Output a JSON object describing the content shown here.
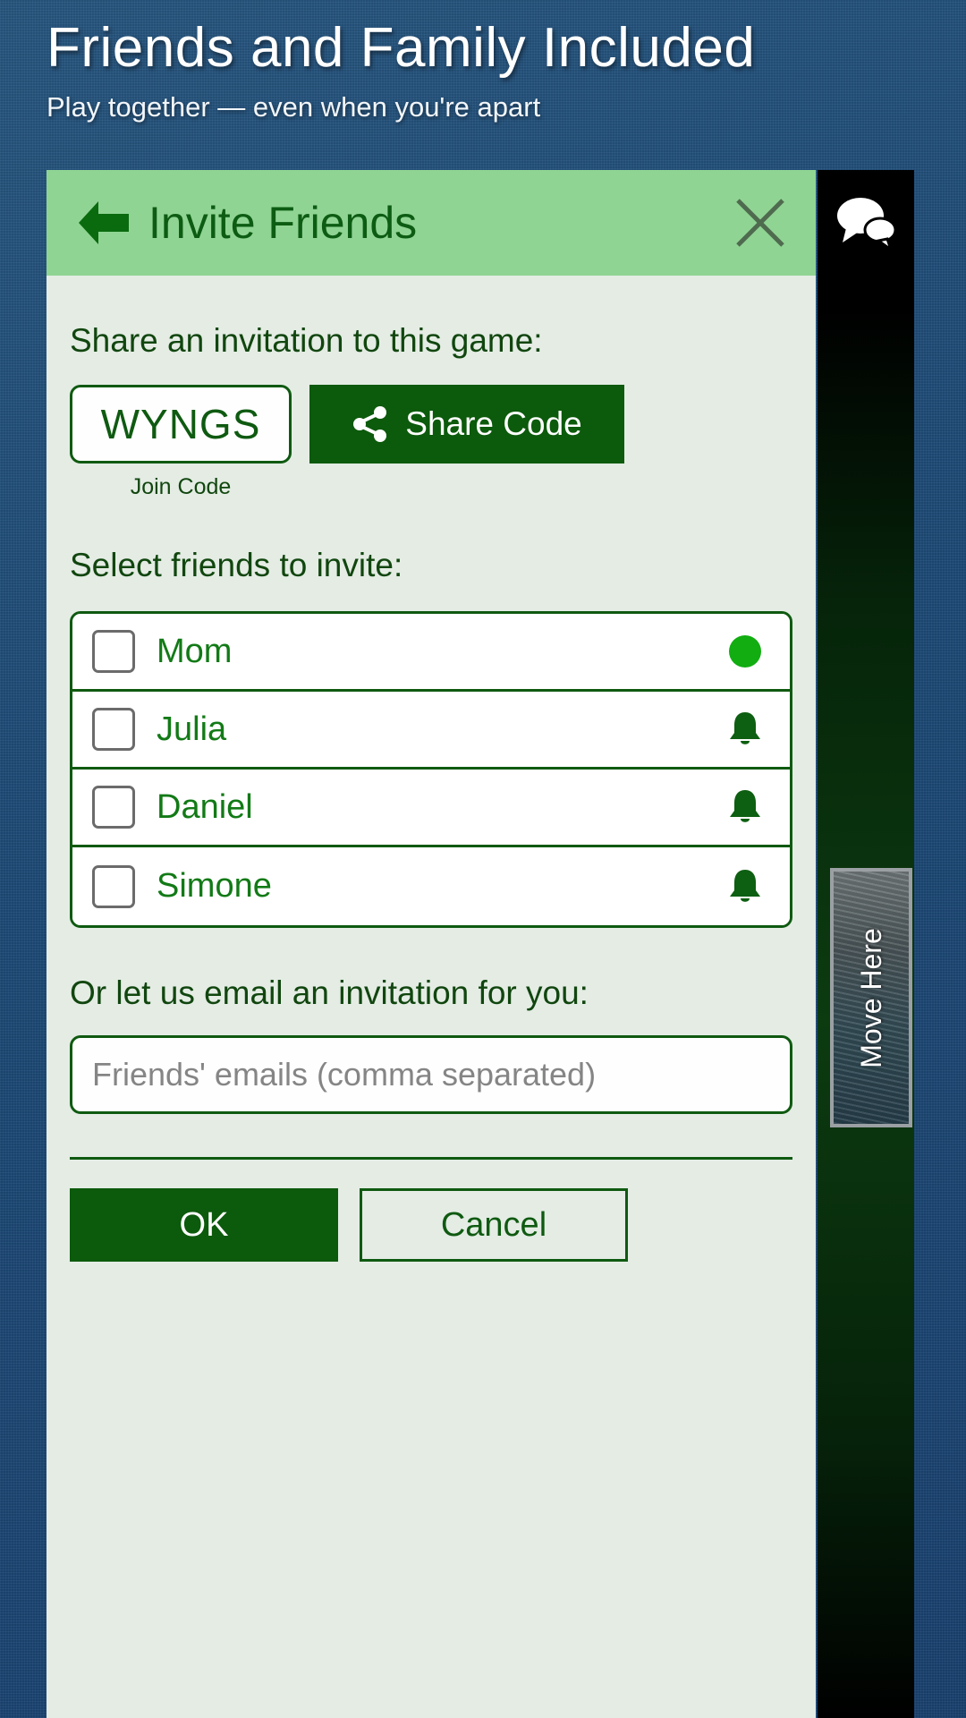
{
  "banner": {
    "title": "Friends and Family Included",
    "subtitle": "Play together — even when you're apart"
  },
  "dialog": {
    "titlebar": {
      "back_icon": "back-arrow-icon",
      "title": "Invite Friends",
      "close_icon": "close-x-icon"
    },
    "share_section": {
      "label": "Share an invitation to this game:",
      "join_code": "WYNGS",
      "join_code_caption": "Join Code",
      "share_button_label": "Share Code",
      "share_button_icon": "share-nodes-icon"
    },
    "friends_section": {
      "label": "Select friends to invite:",
      "friends": [
        {
          "name": "Mom",
          "checked": false,
          "status_icon": "online-dot-icon"
        },
        {
          "name": "Julia",
          "checked": false,
          "status_icon": "bell-icon"
        },
        {
          "name": "Daniel",
          "checked": false,
          "status_icon": "bell-icon"
        },
        {
          "name": "Simone",
          "checked": false,
          "status_icon": "bell-icon"
        }
      ]
    },
    "email_section": {
      "label": "Or let us email an invitation for you:",
      "placeholder": "Friends' emails (comma separated)",
      "value": ""
    },
    "actions": {
      "ok_label": "OK",
      "cancel_label": "Cancel"
    }
  },
  "chat": {
    "bubble_icon": "chat-bubble-icon"
  },
  "move_here": {
    "label": "Move Here"
  },
  "colors": {
    "background_blue": "#1f4e79",
    "titlebar_green": "#90d494",
    "dark_green": "#0c5a0c",
    "panel_bg": "#e4ece4",
    "name_green": "#127a16",
    "online_green": "#11ad11"
  }
}
